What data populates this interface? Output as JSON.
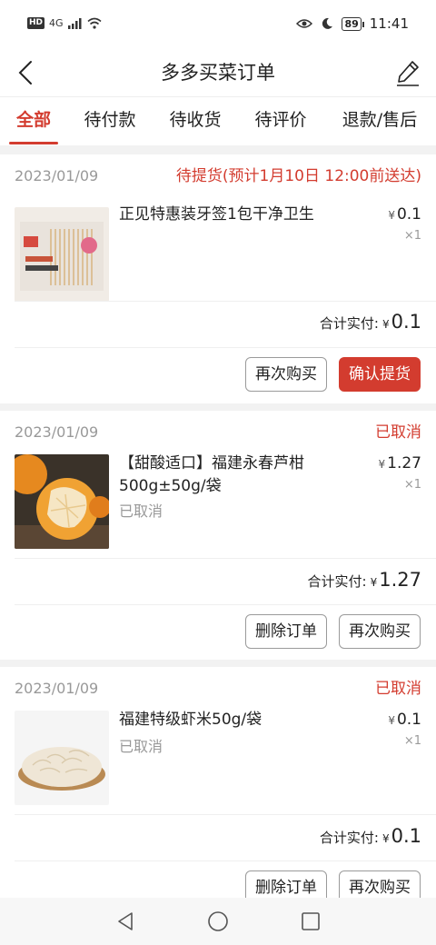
{
  "status_bar": {
    "hd_badge": "HD",
    "network": "4G",
    "battery": "89",
    "time": "11:41"
  },
  "header": {
    "title": "多多买菜订单"
  },
  "tabs": [
    {
      "label": "全部",
      "active": true
    },
    {
      "label": "待付款",
      "active": false
    },
    {
      "label": "待收货",
      "active": false
    },
    {
      "label": "待评价",
      "active": false
    },
    {
      "label": "退款/售后",
      "active": false
    }
  ],
  "orders": [
    {
      "date": "2023/01/09",
      "status": "待提货(预计1月10日 12:00前送达)",
      "product_name": "正见特惠装牙签1包干净卫生",
      "product_sub": "",
      "currency": "¥",
      "price": "0.1",
      "qty": "×1",
      "total_label": "合计实付:",
      "total": "0.1",
      "buttons": [
        "再次购买",
        "确认提货"
      ]
    },
    {
      "date": "2023/01/09",
      "status": "已取消",
      "product_name": "【甜酸适口】福建永春芦柑500g±50g/袋",
      "product_sub": "已取消",
      "currency": "¥",
      "price": "1.27",
      "qty": "×1",
      "total_label": "合计实付:",
      "total": "1.27",
      "buttons": [
        "删除订单",
        "再次购买"
      ]
    },
    {
      "date": "2023/01/09",
      "status": "已取消",
      "product_name": "福建特级虾米50g/袋",
      "product_sub": "已取消",
      "currency": "¥",
      "price": "0.1",
      "qty": "×1",
      "total_label": "合计实付:",
      "total": "0.1",
      "buttons": [
        "删除订单",
        "再次购买"
      ]
    }
  ],
  "colors": {
    "accent": "#d33c2f",
    "muted": "#999999",
    "gap": "#f2f2f2"
  },
  "icons": {
    "back": "back-chevron-icon",
    "edit": "pencil-icon",
    "nav": [
      "back-triangle-icon",
      "home-circle-icon",
      "recents-square-icon"
    ]
  }
}
